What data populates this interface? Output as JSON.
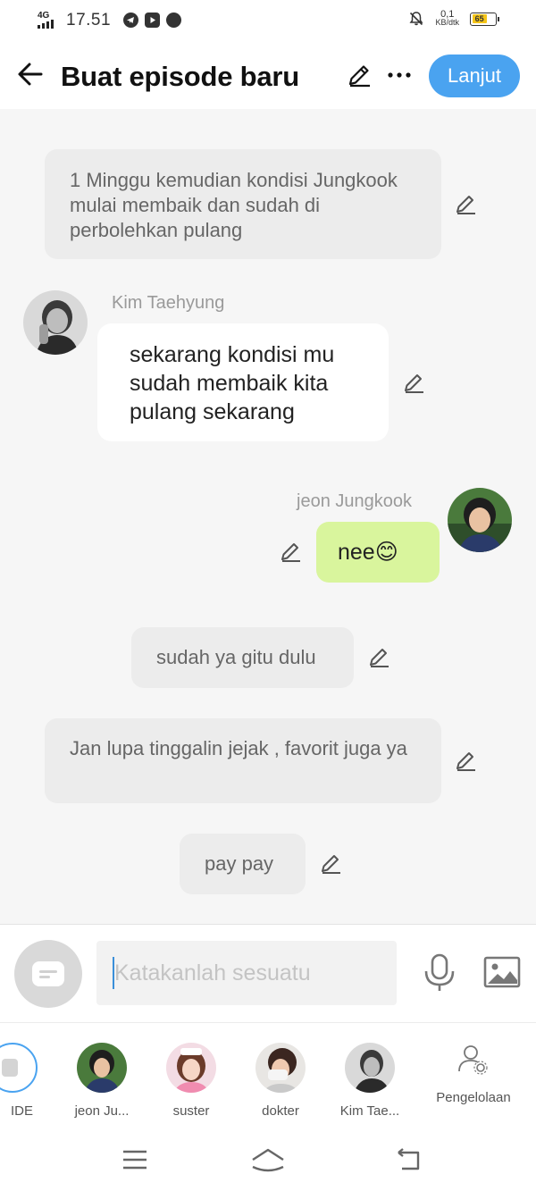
{
  "status_bar": {
    "network": "4G",
    "time": "17.51",
    "speed_value": "0,1",
    "speed_unit": "KB/dtk",
    "battery": "65",
    "battery_level": 0.65
  },
  "header": {
    "title": "Buat episode baru",
    "next_label": "Lanjut"
  },
  "messages": {
    "narration_1": "1 Minggu kemudian kondisi Jungkook mulai membaik dan sudah di perbolehkan pulang",
    "taehyung_name": "Kim Taehyung",
    "taehyung_text": "sekarang kondisi mu sudah membaik kita pulang sekarang",
    "jungkook_name": "jeon Jungkook",
    "jungkook_text": "nee😊",
    "narration_2": "sudah ya gitu dulu",
    "narration_3": "Jan lupa tinggalin jejak , favorit juga ya",
    "narration_4": "pay pay"
  },
  "composer": {
    "placeholder": "Katakanlah sesuatu",
    "value": ""
  },
  "characters": {
    "narrator_label": "IDE",
    "items": [
      {
        "label": "jeon Ju..."
      },
      {
        "label": "suster"
      },
      {
        "label": "dokter"
      },
      {
        "label": "Kim Tae..."
      }
    ],
    "manage_label": "Pengelolaan"
  },
  "colors": {
    "accent": "#4aa3f0",
    "reply_bubble": "#d9f59d",
    "narration_bubble": "#ececec",
    "chat_background": "#f6f6f6"
  }
}
